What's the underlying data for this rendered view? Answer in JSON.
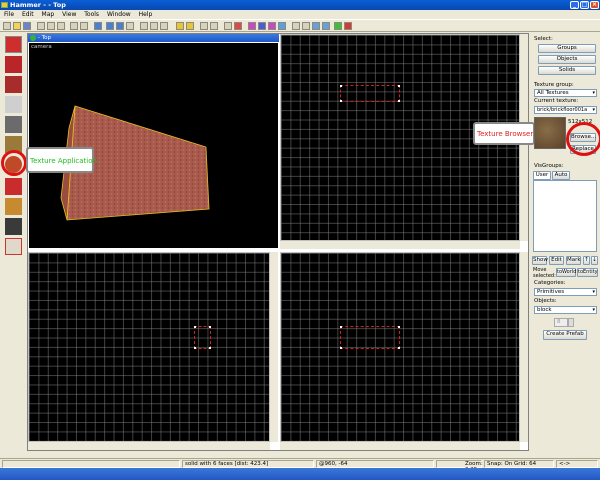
{
  "window": {
    "title": "Hammer - - Top",
    "min": "_",
    "max": "□",
    "close": "×"
  },
  "menu": [
    "File",
    "Edit",
    "Map",
    "View",
    "Tools",
    "Window",
    "Help"
  ],
  "viewport_camera": {
    "title": "- Top",
    "label": "camera"
  },
  "annotations": {
    "texture_application": "Texture Application",
    "texture_browser": "Texture Browser"
  },
  "panel": {
    "select_label": "Select:",
    "groups": "Groups",
    "objects": "Objects",
    "solids": "Solids",
    "texture_group_label": "Texture group:",
    "texture_group_value": "All Textures",
    "current_texture_label": "Current texture:",
    "current_texture_value": "brick/brickfloor001a",
    "texture_size": "512x512",
    "browse": "Browse...",
    "replace": "Replace",
    "visgroups_label": "VisGroups:",
    "tab_user": "User",
    "tab_auto": "Auto",
    "show": "Show",
    "edit": "Edit",
    "mark": "Mark",
    "move_selected": "Move selected:",
    "to_world": "toWorld",
    "to_entity": "toEntity",
    "categories_label": "Categories:",
    "categories_value": "Primitives",
    "objects_label": "Objects:",
    "objects_value": "block",
    "faces_value": "8",
    "create_prefab": "Create Prefab"
  },
  "status": {
    "selection": "solid with 6 faces   [dist: 423.4]",
    "coords": "@960, -64",
    "zoom": "Zoom: 0.25",
    "snap": "Snap: On Grid: 64",
    "arrows": "<->"
  },
  "colors": {
    "titlebar": "#0a5fd6",
    "viewport_bg": "#000000",
    "grid": "#787878",
    "selection": "#cc2222",
    "brush_edge": "#e8c020",
    "callout_green": "#22bb22",
    "callout_red": "#dd2222",
    "highlight_circle": "#dd1111"
  }
}
